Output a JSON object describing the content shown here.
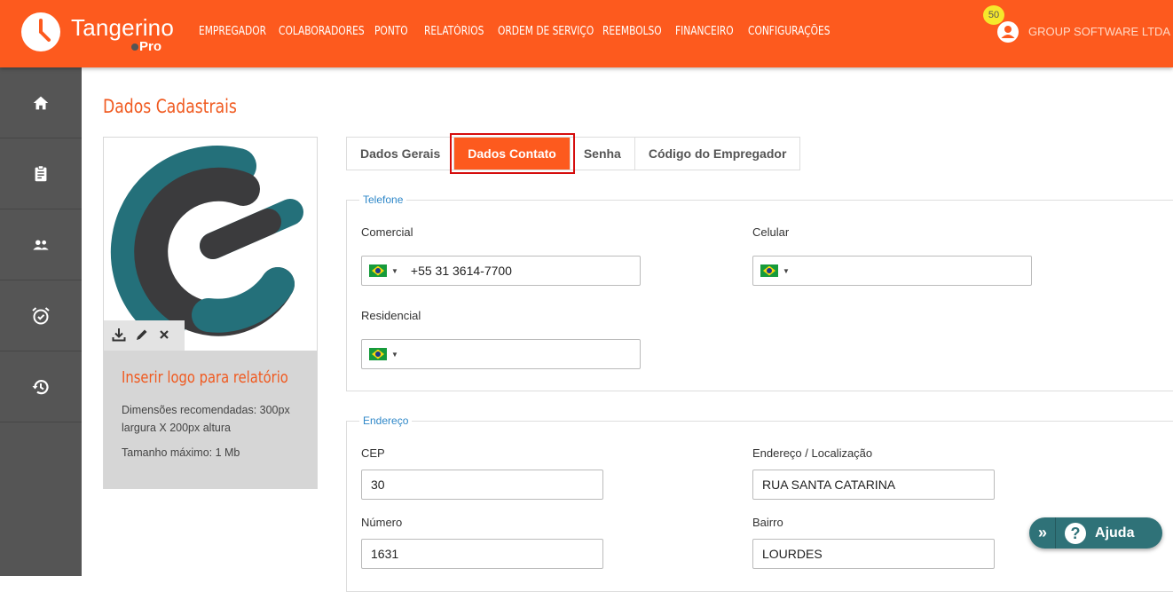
{
  "brand": {
    "name": "Tangerino",
    "sub": "Pro"
  },
  "nav": [
    "EMPREGADOR",
    "COLABORADORES",
    "PONTO",
    "RELATÓRIOS",
    "ORDEM DE SERVIÇO",
    "REEMBOLSO",
    "FINANCEIRO",
    "CONFIGURAÇÕES"
  ],
  "user": {
    "badge": "50",
    "name": "GROUP SOFTWARE LTDA"
  },
  "sidebar": [
    {
      "icon": "home-icon"
    },
    {
      "icon": "clipboard-icon"
    },
    {
      "icon": "people-icon"
    },
    {
      "icon": "alarm-icon"
    },
    {
      "icon": "history-icon"
    }
  ],
  "page": {
    "title": "Dados Cadastrais"
  },
  "logo_card": {
    "title": "Inserir logo para relatório",
    "dims": "Dimensões recomendadas: 300px largura X 200px altura",
    "max": "Tamanho máximo: 1 Mb",
    "colors": {
      "teal": "#24707a",
      "dark": "#3b3b3d"
    }
  },
  "tabs": [
    {
      "label": "Dados Gerais",
      "active": false
    },
    {
      "label": "Dados Contato",
      "active": true
    },
    {
      "label": "Senha",
      "active": false
    },
    {
      "label": "Código do Empregador",
      "active": false
    }
  ],
  "phone": {
    "legend": "Telefone",
    "comercial": {
      "label": "Comercial",
      "value": "+55 31 3614-7700"
    },
    "celular": {
      "label": "Celular",
      "value": ""
    },
    "residencial": {
      "label": "Residencial",
      "value": ""
    }
  },
  "address": {
    "legend": "Endereço",
    "cep": {
      "label": "CEP",
      "value": "30"
    },
    "endereco": {
      "label": "Endereço / Localização",
      "value": "RUA SANTA CATARINA"
    },
    "numero": {
      "label": "Número",
      "value": "1631"
    },
    "bairro": {
      "label": "Bairro",
      "value": "LOURDES"
    }
  },
  "help": {
    "label": "Ajuda"
  },
  "colors": {
    "accent": "#fd5a1e",
    "sidebar": "#555555",
    "legend": "#2e87c8",
    "help": "#2f7278"
  }
}
